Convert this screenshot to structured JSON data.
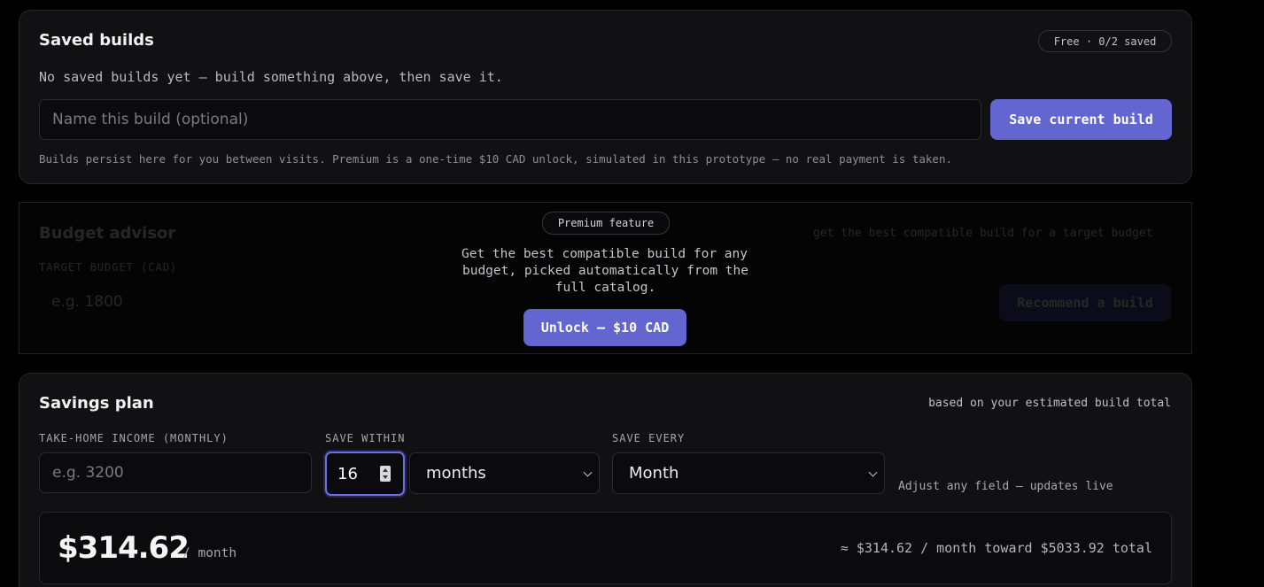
{
  "saved_builds": {
    "title": "Saved builds",
    "badge": "Free · 0/2 saved",
    "empty_text": "No saved builds yet — build something above, then save it.",
    "name_placeholder": "Name this build (optional)",
    "save_button": "Save current build",
    "note": "Builds persist here for you between visits. Premium is a one-time $10 CAD unlock, simulated in this prototype — no real payment is taken."
  },
  "budget_advisor": {
    "title": "Budget advisor",
    "subtitle": "get the best compatible build for a target budget",
    "budget_label": "TARGET BUDGET (CAD)",
    "budget_placeholder": "e.g. 1800",
    "recommend_button": "Recommend a build",
    "premium_badge": "Premium feature",
    "premium_line1": "Get the best compatible build for any",
    "premium_line2": "budget, picked automatically from the",
    "premium_line3": "full catalog.",
    "unlock_button": "Unlock — $10 CAD"
  },
  "savings_plan": {
    "title": "Savings plan",
    "subtitle": "based on your estimated build total",
    "income_label": "TAKE-HOME INCOME (MONTHLY)",
    "income_placeholder": "e.g. 3200",
    "save_within_label": "SAVE WITHIN",
    "save_within_value": "16",
    "save_within_unit": "months",
    "save_every_label": "SAVE EVERY",
    "save_every_value": "Month",
    "hint": "Adjust any field — updates live",
    "amount": "$314.62",
    "amount_unit": "/ month",
    "summary": "≈ $314.62 / month toward $5033.92 total"
  },
  "colors": {
    "accent": "#6366d1",
    "panel": "#111114",
    "background": "#000000"
  }
}
